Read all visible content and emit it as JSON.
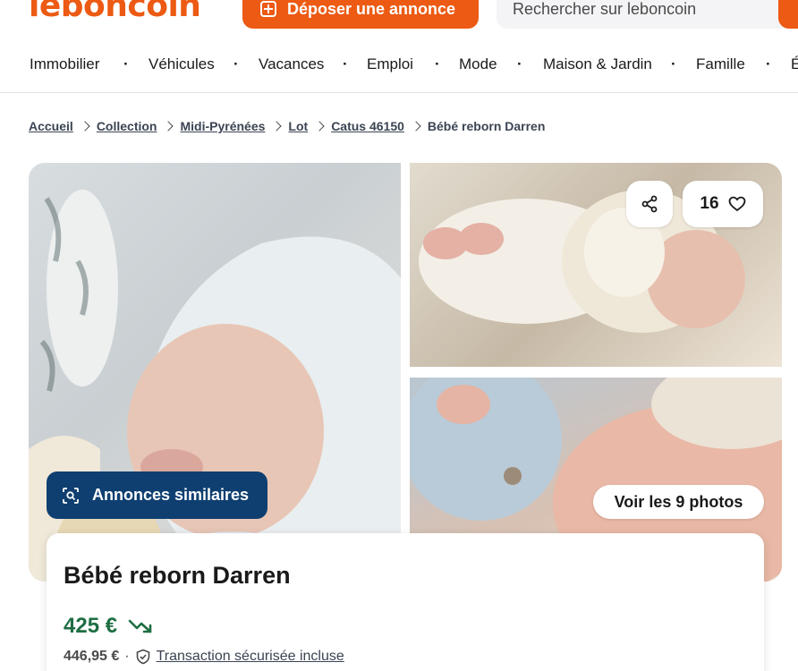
{
  "header": {
    "logo": "leboncoin",
    "deposit_label": "Déposer une annonce",
    "search_placeholder": "Rechercher sur leboncoin"
  },
  "nav": {
    "items": [
      "Immobilier",
      "Véhicules",
      "Vacances",
      "Emploi",
      "Mode",
      "Maison & Jardin",
      "Famille",
      "É"
    ],
    "separator": "·"
  },
  "breadcrumb": {
    "links": [
      "Accueil",
      "Collection",
      "Midi-Pyrénées",
      "Lot",
      "Catus 46150"
    ],
    "current": "Bébé reborn Darren"
  },
  "gallery": {
    "favorites_count": "16",
    "similar_label": "Annonces similaires",
    "see_photos_label": "Voir les 9 photos"
  },
  "ad": {
    "title": "Bébé reborn Darren",
    "price": "425 €",
    "total_price": "446,95 €",
    "dot": "·",
    "secure_label": "Transaction sécurisée incluse"
  },
  "colors": {
    "brand": "#ec5a13",
    "price_green": "#1e6e43",
    "similar_blue": "#0f3f70"
  }
}
